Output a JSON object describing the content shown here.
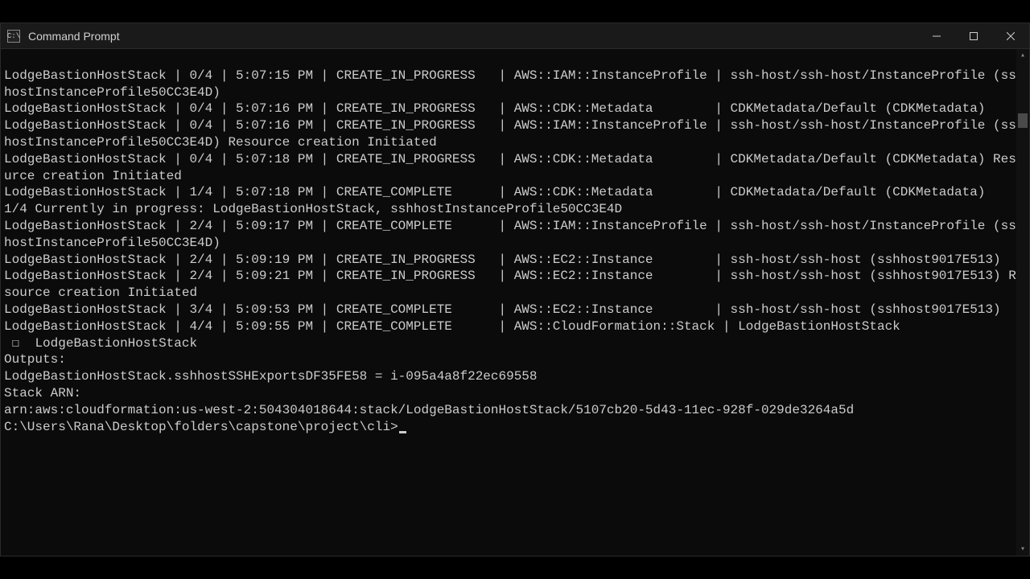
{
  "window": {
    "title": "Command Prompt"
  },
  "lines": [
    "LodgeBastionHostStack | 0/4 | 5:07:15 PM | CREATE_IN_PROGRESS   | AWS::IAM::InstanceProfile | ssh-host/ssh-host/InstanceProfile (sshhostInstanceProfile50CC3E4D)",
    "LodgeBastionHostStack | 0/4 | 5:07:16 PM | CREATE_IN_PROGRESS   | AWS::CDK::Metadata        | CDKMetadata/Default (CDKMetadata)",
    "LodgeBastionHostStack | 0/4 | 5:07:16 PM | CREATE_IN_PROGRESS   | AWS::IAM::InstanceProfile | ssh-host/ssh-host/InstanceProfile (sshhostInstanceProfile50CC3E4D) Resource creation Initiated",
    "LodgeBastionHostStack | 0/4 | 5:07:18 PM | CREATE_IN_PROGRESS   | AWS::CDK::Metadata        | CDKMetadata/Default (CDKMetadata) Resource creation Initiated",
    "LodgeBastionHostStack | 1/4 | 5:07:18 PM | CREATE_COMPLETE      | AWS::CDK::Metadata        | CDKMetadata/Default (CDKMetadata)",
    "1/4 Currently in progress: LodgeBastionHostStack, sshhostInstanceProfile50CC3E4D",
    "LodgeBastionHostStack | 2/4 | 5:09:17 PM | CREATE_COMPLETE      | AWS::IAM::InstanceProfile | ssh-host/ssh-host/InstanceProfile (sshhostInstanceProfile50CC3E4D)",
    "LodgeBastionHostStack | 2/4 | 5:09:19 PM | CREATE_IN_PROGRESS   | AWS::EC2::Instance        | ssh-host/ssh-host (sshhost9017E513)",
    "LodgeBastionHostStack | 2/4 | 5:09:21 PM | CREATE_IN_PROGRESS   | AWS::EC2::Instance        | ssh-host/ssh-host (sshhost9017E513) Resource creation Initiated",
    "LodgeBastionHostStack | 3/4 | 5:09:53 PM | CREATE_COMPLETE      | AWS::EC2::Instance        | ssh-host/ssh-host (sshhost9017E513)",
    "LodgeBastionHostStack | 4/4 | 5:09:55 PM | CREATE_COMPLETE      | AWS::CloudFormation::Stack | LodgeBastionHostStack",
    "",
    " ☐  LodgeBastionHostStack",
    "",
    "Outputs:",
    "LodgeBastionHostStack.sshhostSSHExportsDF35FE58 = i-095a4a8f22ec69558",
    "",
    "Stack ARN:",
    "arn:aws:cloudformation:us-west-2:504304018644:stack/LodgeBastionHostStack/5107cb20-5d43-11ec-928f-029de3264a5d",
    ""
  ],
  "prompt": "C:\\Users\\Rana\\Desktop\\folders\\capstone\\project\\cli>"
}
